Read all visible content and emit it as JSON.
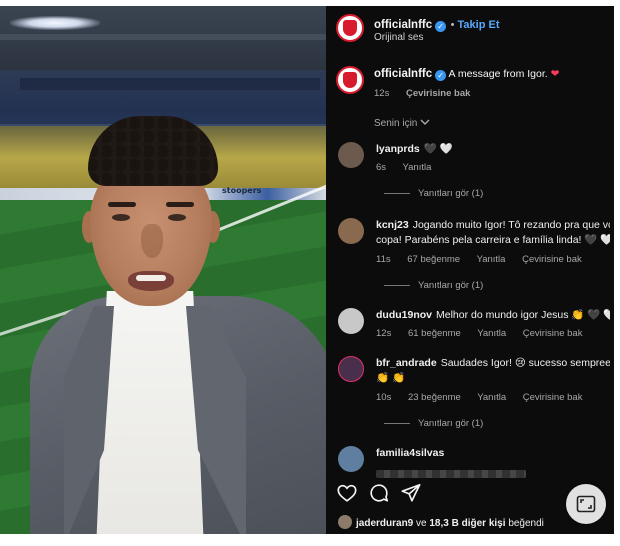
{
  "post": {
    "username": "officialnffc",
    "follow_label": "Takip Et",
    "audio": "Orijinal ses",
    "caption_text": "A message from Igor.",
    "caption_emoji": "❤",
    "caption_time": "12s",
    "translate_label": "Çevirisine bak",
    "sort_label": "Senin için",
    "liked_by_user": "jaderduran9",
    "liked_by_mid": "ve",
    "liked_by_count": "18,3 B diğer kişi",
    "liked_by_tail": "beğendi"
  },
  "media": {
    "adboard_text": "stoopers"
  },
  "comments": [
    {
      "user": "lyanprds",
      "text": "🖤 🤍",
      "time": "6s",
      "likes": "",
      "reply_label": "Yanıtla",
      "translate": "",
      "replies": "Yanıtları gör (1)",
      "avatar_color": "#6b5a4d"
    },
    {
      "user": "kcnj23",
      "text": "Jogando muito Igor! Tô rezando pra que vc",
      "text2": "copa! Parabéns pela carreira e família linda! 🖤 🤍",
      "time": "11s",
      "likes": "67 beğenme",
      "reply_label": "Yanıtla",
      "translate": "Çevirisine bak",
      "replies": "Yanıtları gör (1)",
      "avatar_color": "#8a6a4e"
    },
    {
      "user": "dudu19nov",
      "text": "Melhor do mundo igor Jesus 👏 🖤 🤍",
      "time": "12s",
      "likes": "61 beğenme",
      "reply_label": "Yanıtla",
      "translate": "Çevirisine bak",
      "replies": "",
      "avatar_color": "#c8c8c8"
    },
    {
      "user": "bfr_andrade",
      "text": "Saudades Igor! 😢 sucesso sempreee,",
      "text2": "👏 👏",
      "time": "10s",
      "likes": "23 beğenme",
      "reply_label": "Yanıtla",
      "translate": "Çevirisine bak",
      "replies": "Yanıtları gör (1)",
      "avatar_color": "#4a2f4d"
    },
    {
      "user": "familia4silvas",
      "text": "",
      "time": "",
      "likes": "",
      "reply_label": "",
      "translate": "",
      "replies": "",
      "avatar_color": "#5f7ea0"
    }
  ],
  "icons": {
    "verified": "verified-badge-icon",
    "like": "heart-icon",
    "comment": "comment-icon",
    "share": "send-icon",
    "expand": "fullscreen-icon",
    "chevron": "chevron-down-icon"
  },
  "colors": {
    "panel_bg": "#0c0c0c",
    "follow": "#5aa9ff",
    "verified": "#3897f0",
    "brand_red": "#d81b2c"
  }
}
